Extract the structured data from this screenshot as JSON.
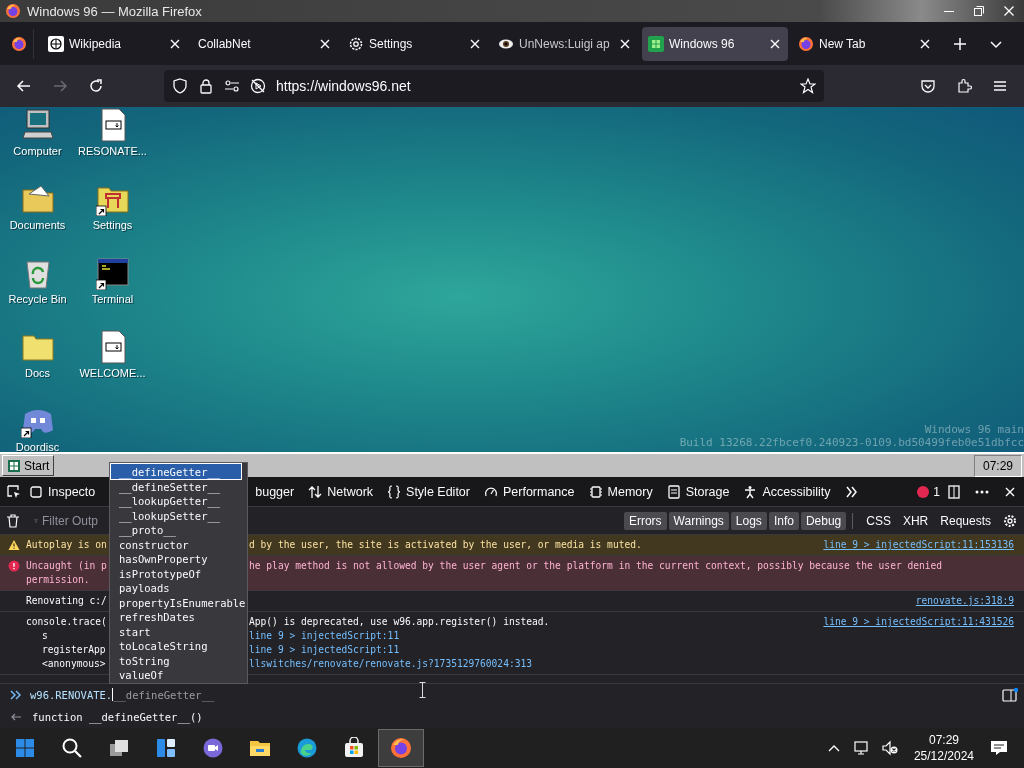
{
  "window": {
    "title": "Windows 96 — Mozilla Firefox"
  },
  "tabs": [
    {
      "label": "Wikipedia",
      "kind": "wiki",
      "selected": false
    },
    {
      "label": "CollabNet",
      "kind": "plain",
      "selected": false
    },
    {
      "label": "Settings",
      "kind": "settings",
      "selected": false
    },
    {
      "label": "UnNews:Luigi ap",
      "kind": "eye",
      "selected": false
    },
    {
      "label": "Windows 96",
      "kind": "w96",
      "selected": true
    },
    {
      "label": "New Tab",
      "kind": "newtab",
      "selected": false
    }
  ],
  "url": "https://windows96.net",
  "desktop": {
    "icons": [
      {
        "label": "Computer",
        "kind": "computer",
        "shortcut": false
      },
      {
        "label": "RESONATE...",
        "kind": "markdown",
        "shortcut": false
      },
      {
        "label": "Documents",
        "kind": "documents",
        "shortcut": false
      },
      {
        "label": "Settings",
        "kind": "settings",
        "shortcut": true
      },
      {
        "label": "Recycle Bin",
        "kind": "recycle",
        "shortcut": false
      },
      {
        "label": "Terminal",
        "kind": "terminal",
        "shortcut": true
      },
      {
        "label": "Docs",
        "kind": "folder",
        "shortcut": false
      },
      {
        "label": "WELCOME...",
        "kind": "markdown",
        "shortcut": false
      },
      {
        "label": "Doordisc",
        "kind": "chat",
        "shortcut": true
      }
    ],
    "build_info": [
      "Windows 96 main",
      "Build 13268.22fbcef0.240923-0109.bd50499feb0e51dbfcc"
    ]
  },
  "w96_taskbar": {
    "start": "Start",
    "clock": "07:29"
  },
  "devtools": {
    "tabs": [
      {
        "label": "Inspecto",
        "kind": "inspector"
      },
      {
        "label": "bugger",
        "kind": "debugger"
      },
      {
        "label": "Network",
        "kind": "network"
      },
      {
        "label": "Style Editor",
        "kind": "style"
      },
      {
        "label": "Performance",
        "kind": "performance"
      },
      {
        "label": "Memory",
        "kind": "memory"
      },
      {
        "label": "Storage",
        "kind": "storage"
      },
      {
        "label": "Accessibility",
        "kind": "accessibility"
      }
    ],
    "error_count": "1",
    "filter": {
      "placeholder": "Filter Outp"
    },
    "levels": [
      {
        "label": "Errors",
        "selected": true
      },
      {
        "label": "Warnings",
        "selected": true
      },
      {
        "label": "Logs",
        "selected": true
      },
      {
        "label": "Info",
        "selected": true
      },
      {
        "label": "Debug",
        "selected": true
      }
    ],
    "request_filters": [
      {
        "label": "CSS",
        "selected": false
      },
      {
        "label": "XHR",
        "selected": false
      },
      {
        "label": "Requests",
        "selected": false
      }
    ],
    "messages": [
      {
        "kind": "warning",
        "text": "Autoplay is on",
        "text_after": "d by the user, the site is activated by the user, or media is muted.",
        "source": "line 9 > injectedScript:11:153136"
      },
      {
        "kind": "error",
        "text": "Uncaught (in p",
        "text_after": "he play method is not allowed by the user agent or the platform in the current context, possibly because the user denied",
        "text_line2": "permission."
      },
      {
        "kind": "log",
        "text": "Renovating c:/",
        "source": "renovate.js:318:9"
      },
      {
        "kind": "trace",
        "text": "console.trace(",
        "text_after": "App() is deprecated, use w96.app.register() instead.",
        "source": "line 9 > injectedScript:11:431526",
        "frames": [
          {
            "name": "s",
            "location": "line 9 > injectedScript:11"
          },
          {
            "name": "registerApp",
            "location": "line 9 > injectedScript:11"
          },
          {
            "name": "<anonymous>",
            "location": "llswitches/renovate/renovate.js?1735129760024:313"
          }
        ]
      }
    ],
    "input": {
      "value": "w96.RENOVATE.",
      "completion": "__defineGetter__"
    },
    "result": "function __defineGetter__()",
    "autocomplete": [
      {
        "label": "__defineGetter__",
        "selected": true
      },
      {
        "label": "__defineSetter__",
        "selected": false
      },
      {
        "label": "__lookupGetter__",
        "selected": false
      },
      {
        "label": "__lookupSetter__",
        "selected": false
      },
      {
        "label": "__proto__",
        "selected": false
      },
      {
        "label": "constructor",
        "selected": false
      },
      {
        "label": "hasOwnProperty",
        "selected": false
      },
      {
        "label": "isPrototypeOf",
        "selected": false
      },
      {
        "label": "payloads",
        "selected": false
      },
      {
        "label": "propertyIsEnumerable",
        "selected": false
      },
      {
        "label": "refreshDates",
        "selected": false
      },
      {
        "label": "start",
        "selected": false
      },
      {
        "label": "toLocaleString",
        "selected": false
      },
      {
        "label": "toString",
        "selected": false
      },
      {
        "label": "valueOf",
        "selected": false
      }
    ]
  },
  "os_taskbar": {
    "apps": [
      {
        "kind": "start",
        "active": false
      },
      {
        "kind": "search",
        "active": false
      },
      {
        "kind": "taskview",
        "active": false
      },
      {
        "kind": "widgets",
        "active": false
      },
      {
        "kind": "chat",
        "active": false
      },
      {
        "kind": "explorer",
        "active": false
      },
      {
        "kind": "edge",
        "active": false
      },
      {
        "kind": "store",
        "active": false
      },
      {
        "kind": "firefox",
        "active": true
      }
    ],
    "time": "07:29",
    "date": "25/12/2024"
  }
}
